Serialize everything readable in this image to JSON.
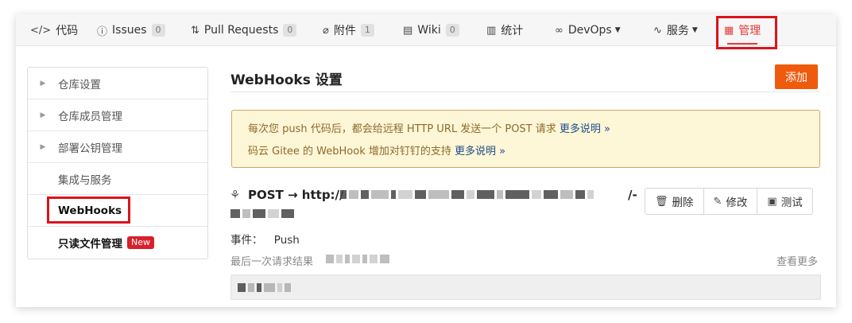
{
  "tabs": [
    {
      "icon": "</>",
      "label": "代码"
    },
    {
      "icon": "ⓘ",
      "label": "Issues",
      "count": "0"
    },
    {
      "icon": "⇅",
      "label": "Pull Requests",
      "count": "0"
    },
    {
      "icon": "⌀",
      "label": "附件",
      "count": "1"
    },
    {
      "icon": "▤",
      "label": "Wiki",
      "count": "0"
    },
    {
      "icon": "▥",
      "label": "统计"
    },
    {
      "icon": "∞",
      "label": "DevOps"
    },
    {
      "icon": "∿",
      "label": "服务"
    },
    {
      "icon": "▦",
      "label": "管理"
    }
  ],
  "sidebar": {
    "items": [
      {
        "label": "仓库设置"
      },
      {
        "label": "仓库成员管理"
      },
      {
        "label": "部署公钥管理"
      },
      {
        "label": "集成与服务"
      },
      {
        "label": "WebHooks"
      },
      {
        "label": "只读文件管理",
        "badge": "New"
      }
    ]
  },
  "main": {
    "title": "WebHooks 设置",
    "add_button": "添加",
    "notice": {
      "line1": "每次您 push 代码后，都会给远程 HTTP URL 发送一个 POST 请求",
      "line1_link": "更多说明 »",
      "line2": "码云 Gitee 的 WebHook 增加对钉钉的支持",
      "line2_link": "更多说明 »"
    },
    "hook": {
      "title_prefix": "POST → http://",
      "url_suffix": "/-",
      "actions": [
        {
          "icon": "trash-icon",
          "label": "删除"
        },
        {
          "icon": "edit-icon",
          "label": "修改"
        },
        {
          "icon": "terminal-icon",
          "label": "测试"
        }
      ],
      "event_label": "事件：",
      "event_value": "Push",
      "last_request_label": "最后一次请求结果",
      "see_more": "查看更多"
    }
  },
  "colors": {
    "accent_red": "#e4393c",
    "add_button": "#f05a0d",
    "notice_bg": "#fdf6d7",
    "link": "#1c4d88"
  }
}
